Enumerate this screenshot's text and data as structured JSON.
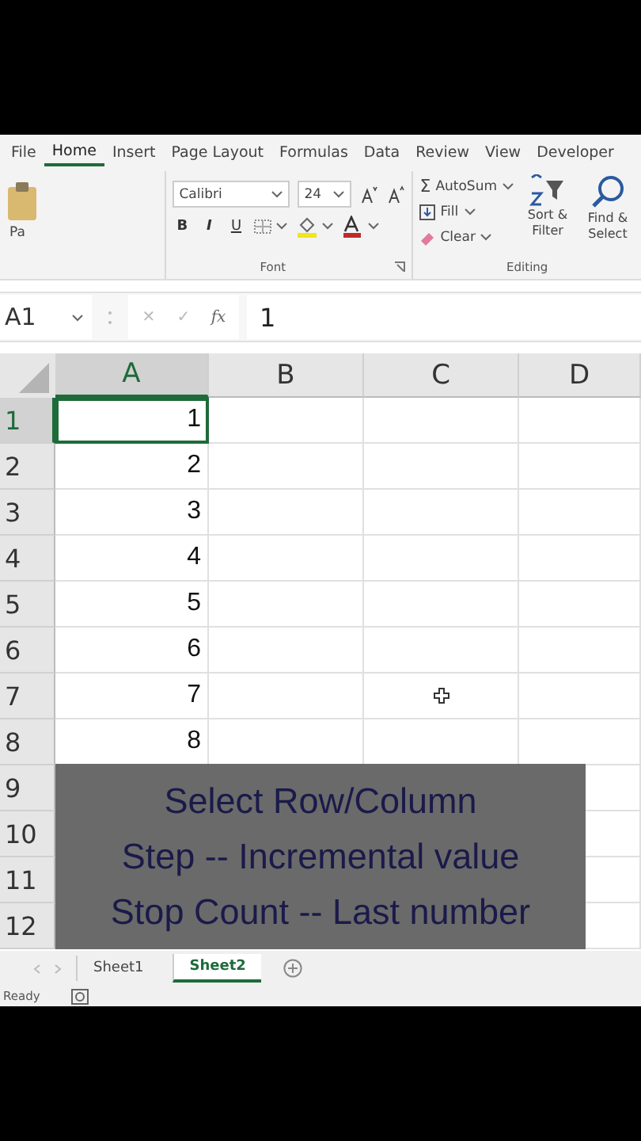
{
  "ribbon_tabs": [
    {
      "label": "File",
      "selected": false
    },
    {
      "label": "Home",
      "selected": true
    },
    {
      "label": "Insert",
      "selected": false
    },
    {
      "label": "Page Layout",
      "selected": false
    },
    {
      "label": "Formulas",
      "selected": false
    },
    {
      "label": "Data",
      "selected": false
    },
    {
      "label": "Review",
      "selected": false
    },
    {
      "label": "View",
      "selected": false
    },
    {
      "label": "Developer",
      "selected": false
    }
  ],
  "clipboard": {
    "label": "Pa"
  },
  "font": {
    "name": "Calibri",
    "size": "24",
    "styles": [
      "B",
      "I",
      "U"
    ],
    "group_label": "Font"
  },
  "editing": {
    "sigma": "Σ",
    "items": [
      "AutoSum",
      "Fill",
      "Clear"
    ],
    "sort": "Sort & Filter",
    "find": "Find & Select",
    "group_label": "Editing"
  },
  "formula_bar": {
    "name_box": "A1",
    "cancel": "✕",
    "enter": "✓",
    "fx": "fx",
    "value": "1"
  },
  "columns": [
    {
      "label": "A",
      "selected": true
    },
    {
      "label": "B",
      "selected": false
    },
    {
      "label": "C",
      "selected": false
    },
    {
      "label": "D",
      "selected": false
    }
  ],
  "rows": [
    {
      "number": "1",
      "value": "1",
      "selected": true
    },
    {
      "number": "2",
      "value": "2",
      "selected": false
    },
    {
      "number": "3",
      "value": "3",
      "selected": false
    },
    {
      "number": "4",
      "value": "4",
      "selected": false
    },
    {
      "number": "5",
      "value": "5",
      "selected": false
    },
    {
      "number": "6",
      "value": "6",
      "selected": false
    },
    {
      "number": "7",
      "value": "7",
      "selected": false
    },
    {
      "number": "8",
      "value": "8",
      "selected": false
    },
    {
      "number": "9",
      "selected": false
    },
    {
      "number": "10",
      "selected": false
    },
    {
      "number": "11",
      "selected": false
    },
    {
      "number": "12",
      "selected": false
    }
  ],
  "caption": [
    "Select Row/Column",
    "Step -- Incremental value",
    "Stop Count -- Last number"
  ],
  "sheet_tabs": [
    {
      "label": "Sheet1",
      "selected": false
    },
    {
      "label": "Sheet2",
      "selected": true
    }
  ],
  "status": "Ready"
}
